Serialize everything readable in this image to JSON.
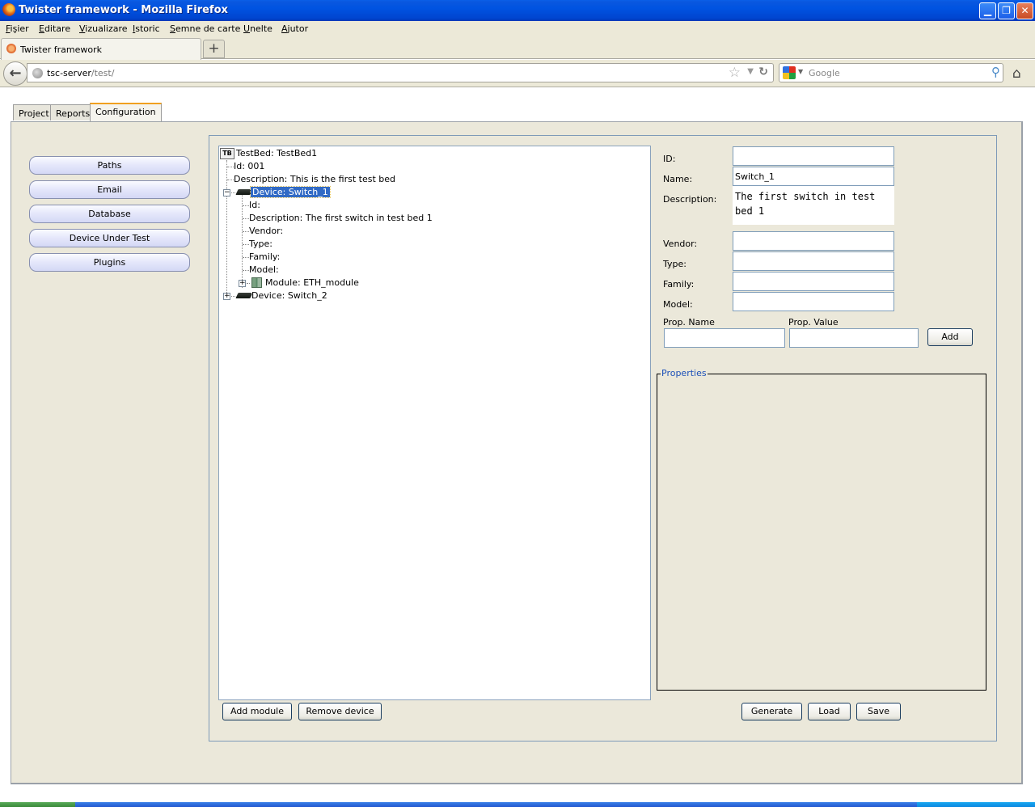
{
  "window": {
    "title": "Twister framework - Mozilla Firefox",
    "controls": {
      "minimize": "▁",
      "restore": "❐",
      "close": "✕"
    }
  },
  "menu": [
    "Fişier",
    "Editare",
    "Vizualizare",
    "Istoric",
    "Semne de carte",
    "Unelte",
    "Ajutor"
  ],
  "browser_tab": {
    "label": "Twister framework",
    "new_tab": "+"
  },
  "navbar": {
    "back_icon": "←",
    "url_host": "tsc-server",
    "url_path": "/test/",
    "bookmark_icon": "☆",
    "dropdown_icon": "▼",
    "reload_icon": "↻",
    "search_placeholder": "Google",
    "search_dropdown_icon": "▼",
    "search_icon": "⚲",
    "home_icon": "⌂"
  },
  "app_tabs": [
    {
      "label": "Project",
      "active": false
    },
    {
      "label": "Reports",
      "active": false
    },
    {
      "label": "Configuration",
      "active": true
    }
  ],
  "sidebar": {
    "items": [
      {
        "label": "Paths"
      },
      {
        "label": "Email"
      },
      {
        "label": "Database"
      },
      {
        "label": "Device Under Test"
      },
      {
        "label": "Plugins"
      }
    ]
  },
  "tree": {
    "root_icon": "TB",
    "root": "TestBed: TestBed1",
    "root_children": [
      "Id: 001",
      "Description: This is the first test bed"
    ],
    "device1": {
      "label": "Device: Switch_1",
      "expanded": true,
      "selected": true,
      "expander": "−",
      "children": [
        "Id:",
        "Description: The first switch in test bed 1",
        "Vendor:",
        "Type:",
        "Family:",
        "Model:"
      ],
      "module": {
        "label": "Module: ETH_module",
        "expander": "+"
      }
    },
    "device2": {
      "label": "Device: Switch_2",
      "expander": "+"
    }
  },
  "form": {
    "labels": {
      "id": "ID:",
      "name": "Name:",
      "description": "Description:",
      "vendor": "Vendor:",
      "type": "Type:",
      "family": "Family:",
      "model": "Model:",
      "prop_name": "Prop. Name",
      "prop_value": "Prop. Value"
    },
    "values": {
      "id": "",
      "name": "Switch_1",
      "description": "The first switch in test bed 1",
      "vendor": "",
      "type": "",
      "family": "",
      "model": "",
      "prop_name": "",
      "prop_value": ""
    },
    "add_button": "Add",
    "properties_legend": "Properties"
  },
  "buttons": {
    "add_module": "Add module",
    "remove_device": "Remove device",
    "generate": "Generate",
    "load": "Load",
    "save": "Save"
  }
}
